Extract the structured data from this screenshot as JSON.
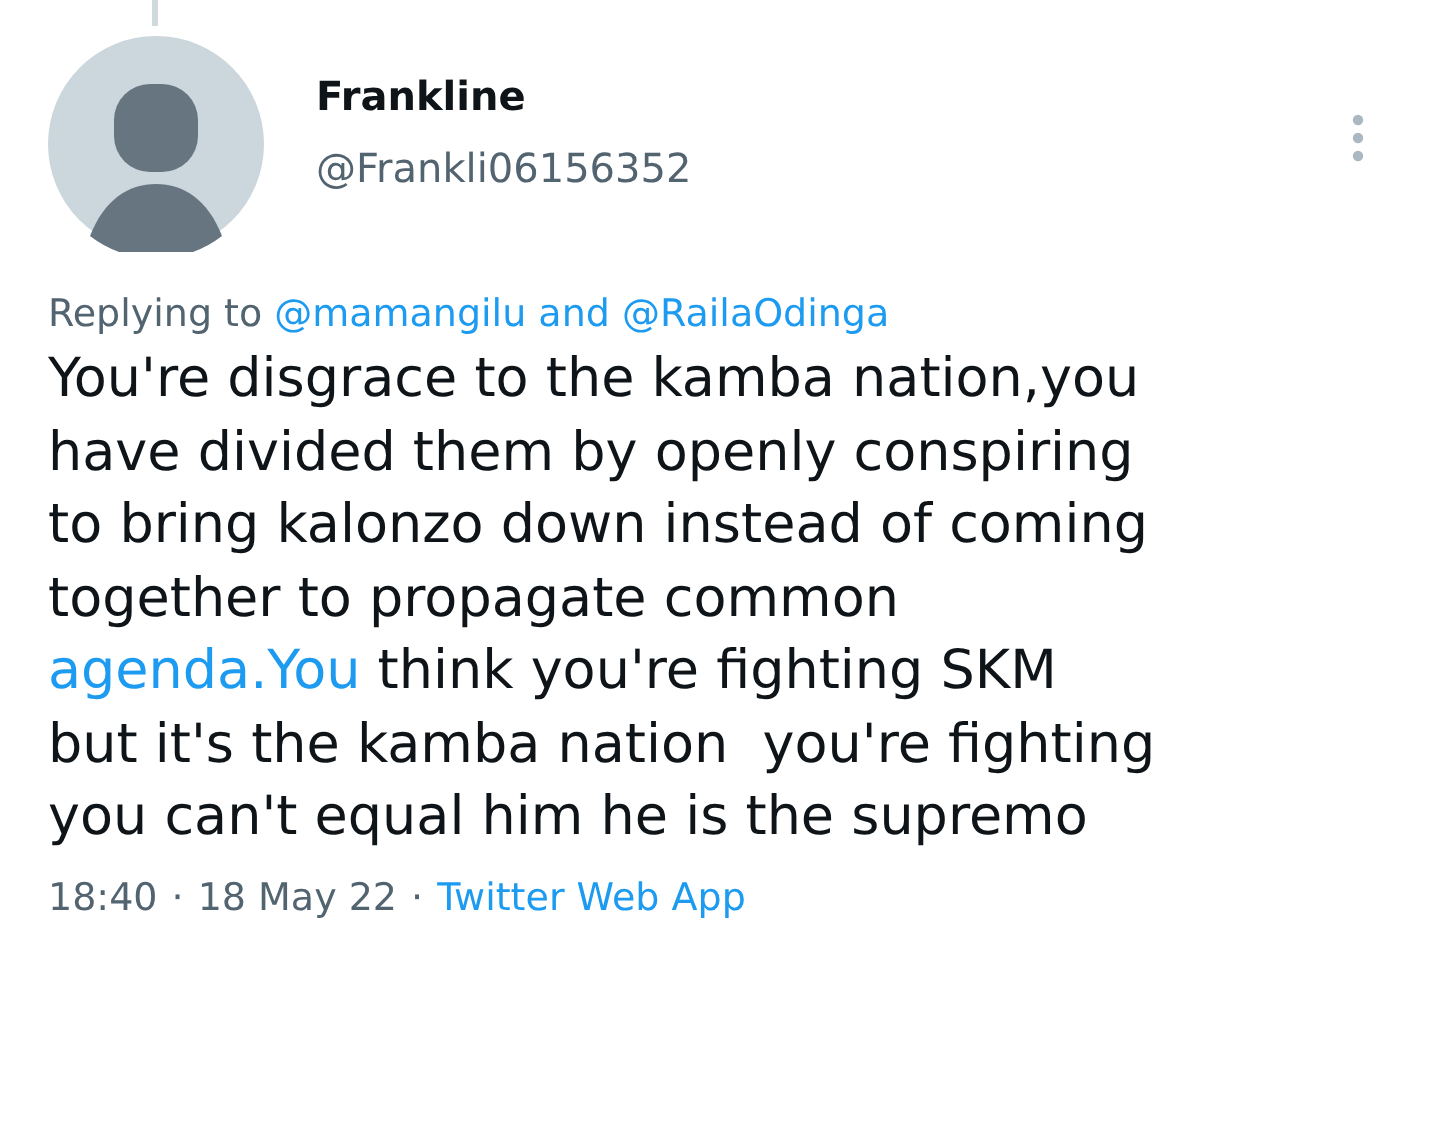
{
  "tweet": {
    "author": {
      "name": "Frankline",
      "handle": "@Frankli06156352"
    },
    "reply": {
      "label": "Replying to",
      "link": "@mamangilu and @RailaOdinga"
    },
    "body": [
      {
        "kind": "text",
        "text": "You're disgrace to the kamba nation,you\nhave divided them by openly conspiring\nto bring kalonzo down instead of coming\ntogether to propagate common\n"
      },
      {
        "kind": "link",
        "text": "agenda.You"
      },
      {
        "kind": "text",
        "text": " think you're fighting SKM\nbut it's the kamba nation  you're fighting\nyou can't equal him he is the supremo"
      }
    ],
    "meta": {
      "time": "18:40",
      "separator": "·",
      "date": "18 May 22",
      "separator2": "·",
      "source": "Twitter Web App"
    }
  }
}
